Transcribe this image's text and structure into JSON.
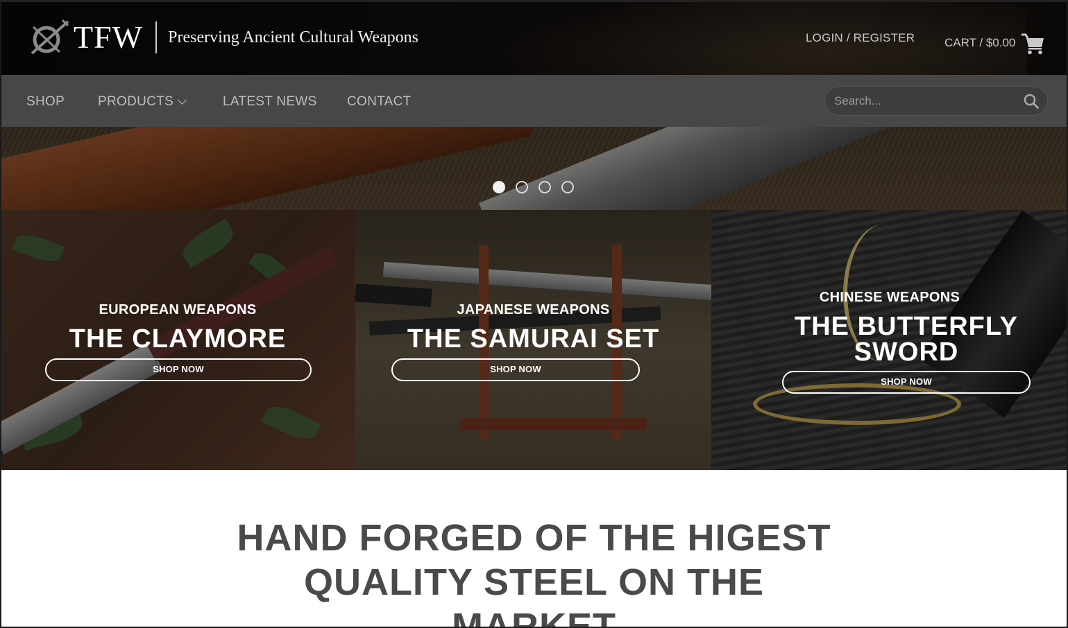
{
  "header": {
    "logo_text": "TFW",
    "tagline": "Preserving Ancient Cultural Weapons",
    "account_link": "LOGIN / REGISTER",
    "cart_label": "CART / $0.00"
  },
  "nav": {
    "items": [
      {
        "label": "SHOP"
      },
      {
        "label": "PRODUCTS"
      },
      {
        "label": "LATEST NEWS"
      },
      {
        "label": "CONTACT"
      }
    ],
    "search_placeholder": "Search..."
  },
  "slider": {
    "dots": 4,
    "active_index": 0
  },
  "categories": [
    {
      "subtitle": "EUROPEAN WEAPONS",
      "title": "THE CLAYMORE",
      "button": "SHOP NOW"
    },
    {
      "subtitle": "JAPANESE WEAPONS",
      "title": "THE SAMURAI SET",
      "button": "SHOP NOW"
    },
    {
      "subtitle": "CHINESE WEAPONS",
      "title": "THE BUTTERFLY SWORD",
      "button": "SHOP NOW"
    }
  ],
  "main": {
    "headline": "HAND FORGED OF THE HIGEST QUALITY STEEL ON THE MARKET"
  },
  "colors": {
    "header_bg": "#050505",
    "nav_bg": "#474747",
    "nav_text": "#bdbdbd",
    "headline_text": "#4a4a4a"
  }
}
